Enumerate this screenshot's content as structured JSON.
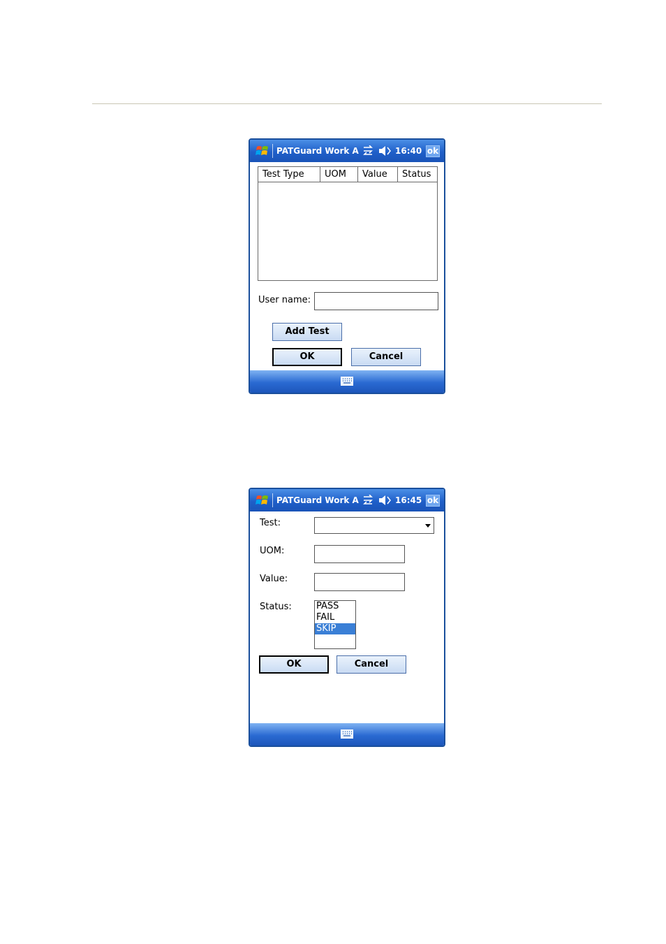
{
  "screen1": {
    "app_title": "PATGuard Work Al",
    "time": "16:40",
    "ok_label": "ok",
    "columns": [
      "Test Type",
      "UOM",
      "Value",
      "Status"
    ],
    "user_name_label": "User name:",
    "user_name_value": "",
    "add_test_label": "Add Test",
    "ok_button_label": "OK",
    "cancel_button_label": "Cancel"
  },
  "screen2": {
    "app_title": "PATGuard Work Al",
    "time": "16:45",
    "ok_label": "ok",
    "test_label": "Test:",
    "test_value": "",
    "uom_label": "UOM:",
    "uom_value": "",
    "value_label": "Value:",
    "value_value": "",
    "status_label": "Status:",
    "status_options": [
      "PASS",
      "FAIL",
      "SKIP"
    ],
    "status_selected": "SKIP",
    "ok_button_label": "OK",
    "cancel_button_label": "Cancel"
  },
  "icons": {
    "start": "windows-start-icon",
    "connectivity": "connectivity-icon",
    "volume": "volume-muted-icon",
    "keyboard": "keyboard-icon"
  },
  "colors": {
    "titlebar": "#1f5fc9",
    "selection": "#3a7fd6",
    "button_face": "#c9dbf3"
  }
}
